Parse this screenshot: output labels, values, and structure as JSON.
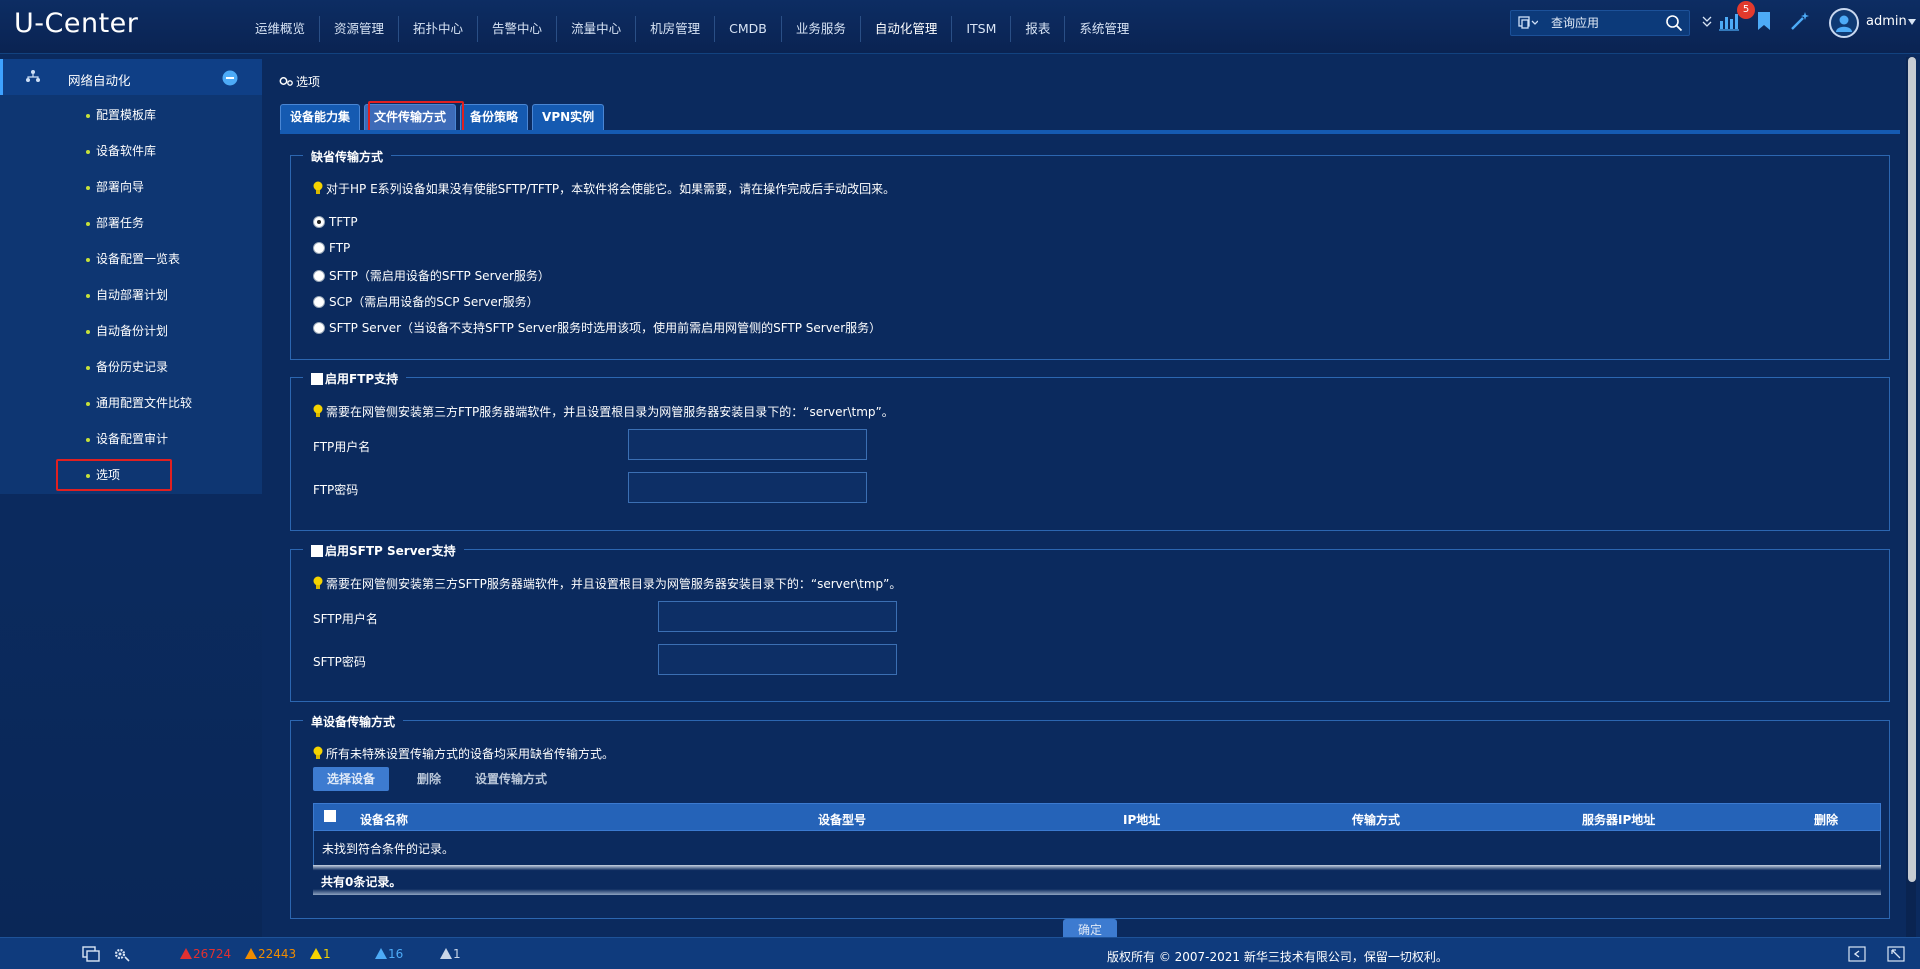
{
  "app": {
    "logo": "U-Center"
  },
  "topnav": [
    {
      "label": "运维概览"
    },
    {
      "label": "资源管理"
    },
    {
      "label": "拓扑中心"
    },
    {
      "label": "告警中心"
    },
    {
      "label": "流量中心"
    },
    {
      "label": "机房管理"
    },
    {
      "label": "CMDB"
    },
    {
      "label": "业务服务"
    },
    {
      "label": "自动化管理",
      "active": true
    },
    {
      "label": "ITSM"
    },
    {
      "label": "报表"
    },
    {
      "label": "系统管理"
    }
  ],
  "header": {
    "search_placeholder": "查询应用",
    "notification_count": "5",
    "user_name": "admin",
    "icons": [
      "app-switch-icon",
      "search-icon",
      "expand-icon",
      "report-icon",
      "bookmark-icon",
      "magic-wand-icon",
      "user-icon"
    ]
  },
  "sidebar": {
    "group_label": "网络自动化",
    "items": [
      {
        "label": "配置模板库"
      },
      {
        "label": "设备软件库"
      },
      {
        "label": "部署向导"
      },
      {
        "label": "部署任务"
      },
      {
        "label": "设备配置一览表"
      },
      {
        "label": "自动部署计划"
      },
      {
        "label": "自动备份计划"
      },
      {
        "label": "备份历史记录"
      },
      {
        "label": "通用配置文件比较"
      },
      {
        "label": "设备配置审计"
      },
      {
        "label": "选项",
        "selected": true
      }
    ]
  },
  "main": {
    "breadcrumb": "选项",
    "tabs": [
      {
        "label": "设备能力集"
      },
      {
        "label": "文件传输方式",
        "active": true
      },
      {
        "label": "备份策略"
      },
      {
        "label": "VPN实例"
      }
    ],
    "default_transfer": {
      "legend": "缺省传输方式",
      "tip": "对于HP E系列设备如果没有使能SFTP/TFTP，本软件将会使能它。如果需要，请在操作完成后手动改回来。",
      "options": [
        {
          "label": "TFTP",
          "checked": true
        },
        {
          "label": "FTP"
        },
        {
          "label": "SFTP（需启用设备的SFTP Server服务）"
        },
        {
          "label": "SCP（需启用设备的SCP Server服务）"
        },
        {
          "label": "SFTP Server（当设备不支持SFTP Server服务时选用该项，使用前需启用网管侧的SFTP Server服务）"
        }
      ]
    },
    "ftp": {
      "legend": "启用FTP支持",
      "tip": "需要在网管侧安装第三方FTP服务器端软件，并且设置根目录为网管服务器安装目录下的：“server\\tmp”。",
      "username_label": "FTP用户名",
      "password_label": "FTP密码",
      "username_value": "",
      "password_value": ""
    },
    "sftp": {
      "legend": "启用SFTP Server支持",
      "tip": "需要在网管侧安装第三方SFTP服务器端软件，并且设置根目录为网管服务器安装目录下的：“server\\tmp”。",
      "username_label": "SFTP用户名",
      "password_label": "SFTP密码",
      "username_value": "",
      "password_value": ""
    },
    "single_device": {
      "legend": "单设备传输方式",
      "tip": "所有未特殊设置传输方式的设备均采用缺省传输方式。",
      "select_button": "选择设备",
      "delete_button": "删除",
      "set_button": "设置传输方式",
      "columns": [
        "设备名称",
        "设备型号",
        "IP地址",
        "传输方式",
        "服务器IP地址",
        "删除"
      ],
      "empty_text": "未找到符合条件的记录。",
      "footer_text": "共有0条记录。"
    },
    "confirm_button": "确定"
  },
  "footer": {
    "alarms": [
      {
        "value": "26724",
        "color": "#e03131"
      },
      {
        "value": "22443",
        "color": "#f08c00"
      },
      {
        "value": "1",
        "color": "#f5d300"
      },
      {
        "value": "16",
        "color": "#4dabf7"
      },
      {
        "value": "1",
        "color": "#c9d6e8"
      }
    ],
    "copyright": "版权所有 © 2007-2021 新华三技术有限公司，保留一切权利。"
  }
}
